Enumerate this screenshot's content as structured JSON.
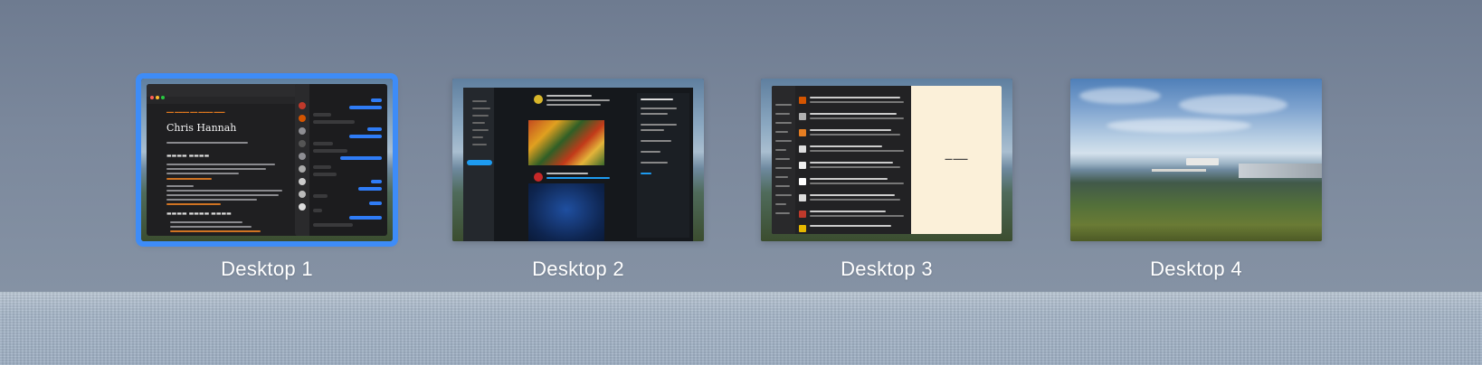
{
  "spaces": [
    {
      "label": "Desktop 1",
      "selected": true
    },
    {
      "label": "Desktop 2",
      "selected": false
    },
    {
      "label": "Desktop 3",
      "selected": false
    },
    {
      "label": "Desktop 4",
      "selected": false
    }
  ],
  "thumb1": {
    "page_heading": "Chris Hannah"
  },
  "colors": {
    "selection": "#3e8cf7",
    "label_text": "#ffffff",
    "accent_orange": "#e0781f",
    "message_blue": "#2f7cf6"
  }
}
